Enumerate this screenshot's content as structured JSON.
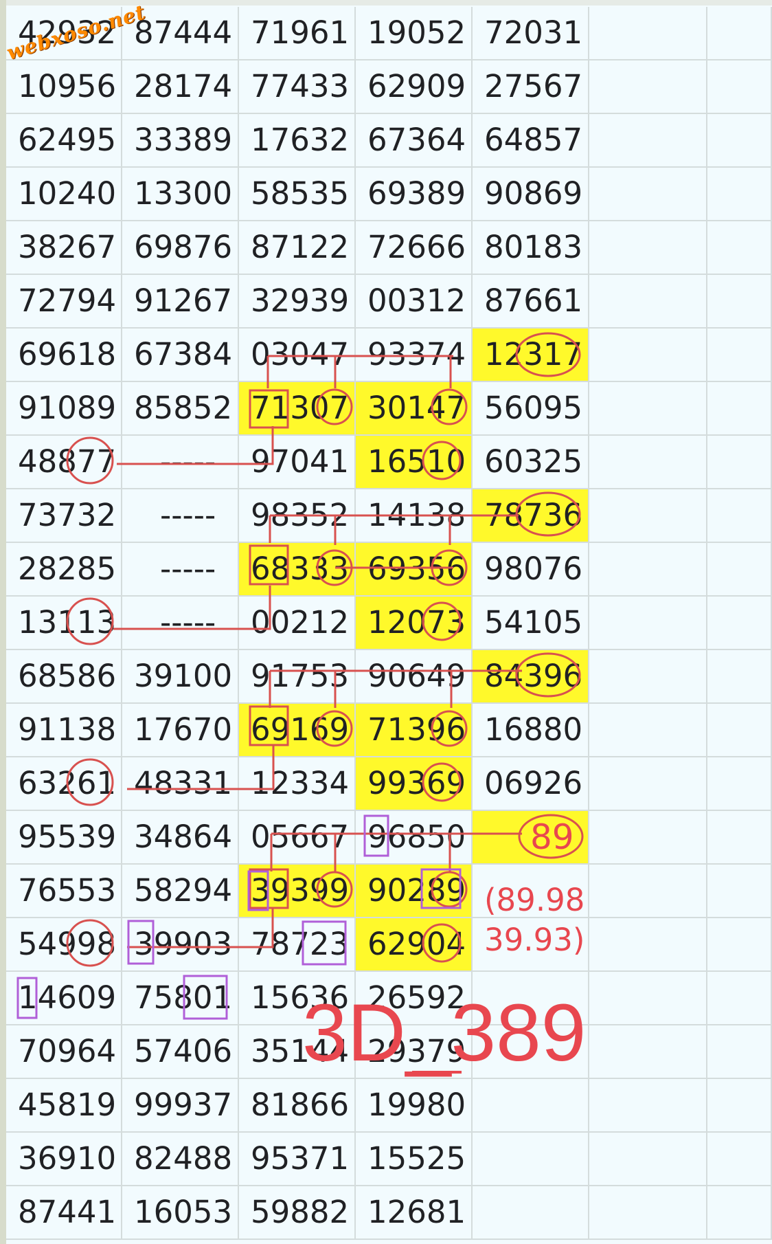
{
  "watermark": "webxoso.net",
  "rows": [
    [
      "42932",
      "87444",
      "71961",
      "19052",
      "72031"
    ],
    [
      "10956",
      "28174",
      "77433",
      "62909",
      "27567"
    ],
    [
      "62495",
      "33389",
      "17632",
      "67364",
      "64857"
    ],
    [
      "10240",
      "13300",
      "58535",
      "69389",
      "90869"
    ],
    [
      "38267",
      "69876",
      "87122",
      "72666",
      "80183"
    ],
    [
      "72794",
      "91267",
      "32939",
      "00312",
      "87661"
    ],
    [
      "69618",
      "67384",
      "03047",
      "93374",
      "12317"
    ],
    [
      "91089",
      "85852",
      "71307",
      "30147",
      "56095"
    ],
    [
      "48877",
      "-----",
      "97041",
      "16510",
      "60325"
    ],
    [
      "73732",
      "-----",
      "98352",
      "14138",
      "78736"
    ],
    [
      "28285",
      "-----",
      "68333",
      "69356",
      "98076"
    ],
    [
      "13113",
      "-----",
      "00212",
      "12073",
      "54105"
    ],
    [
      "68586",
      "39100",
      "91753",
      "90649",
      "84396"
    ],
    [
      "91138",
      "17670",
      "69169",
      "71396",
      "16880"
    ],
    [
      "63261",
      "48331",
      "12334",
      "99369",
      "06926"
    ],
    [
      "95539",
      "34864",
      "05667",
      "96850",
      ""
    ],
    [
      "76553",
      "58294",
      "39399",
      "90289",
      ""
    ],
    [
      "54998",
      "39903",
      "78723",
      "62904",
      ""
    ],
    [
      "14609",
      "75801",
      "15636",
      "26592",
      ""
    ],
    [
      "70964",
      "57406",
      "35144",
      "29379",
      ""
    ],
    [
      "45819",
      "99937",
      "81866",
      "19980",
      ""
    ],
    [
      "36910",
      "82488",
      "95371",
      "15525",
      ""
    ],
    [
      "87441",
      "16053",
      "59882",
      "12681",
      ""
    ]
  ],
  "highlights": [
    [
      6,
      4
    ],
    [
      7,
      2
    ],
    [
      7,
      3
    ],
    [
      8,
      3
    ],
    [
      9,
      4
    ],
    [
      10,
      2
    ],
    [
      10,
      3
    ],
    [
      11,
      3
    ],
    [
      12,
      4
    ],
    [
      13,
      2
    ],
    [
      13,
      3
    ],
    [
      14,
      3
    ],
    [
      15,
      4
    ],
    [
      16,
      2
    ],
    [
      16,
      3
    ],
    [
      17,
      3
    ]
  ],
  "annotation": {
    "pair_number": "89",
    "note_line_1": "(89.98",
    "note_line_2": "39.93)",
    "prediction": "3D_389"
  },
  "colors": {
    "highlight": "#fff92b",
    "annotation_red": "#e8474f",
    "marker_purple": "#b05fd8",
    "grid_line": "#d4dcdc",
    "background": "#f2fbfe"
  }
}
